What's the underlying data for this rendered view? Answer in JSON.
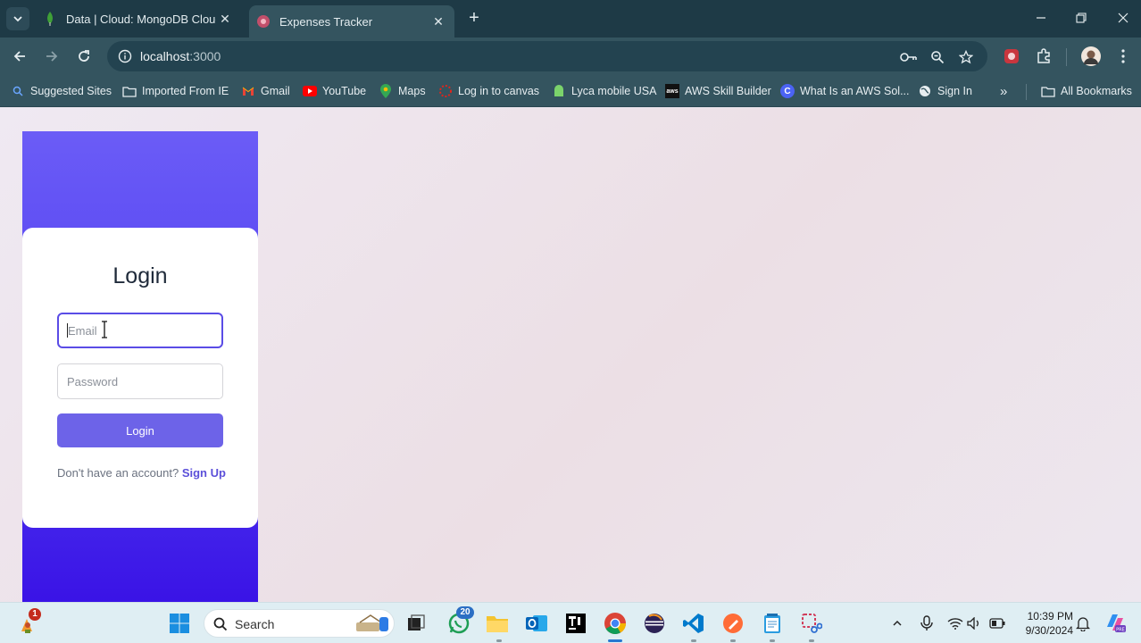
{
  "browser": {
    "tabs": [
      {
        "title": "Data | Cloud: MongoDB Cloud",
        "favicon": "mongodb-leaf-icon",
        "active": false
      },
      {
        "title": "Expenses Tracker",
        "favicon": "react-app-icon",
        "active": true
      }
    ],
    "url": {
      "host": "localhost",
      "port": ":3000"
    },
    "bookmarks": [
      {
        "label": "Suggested Sites",
        "icon": "suggested-sites-icon"
      },
      {
        "label": "Imported From IE",
        "icon": "folder-icon"
      },
      {
        "label": "Gmail",
        "icon": "gmail-icon"
      },
      {
        "label": "YouTube",
        "icon": "youtube-icon"
      },
      {
        "label": "Maps",
        "icon": "maps-icon"
      },
      {
        "label": "Log in to canvas",
        "icon": "canvas-icon"
      },
      {
        "label": "Lyca mobile USA",
        "icon": "lyca-icon"
      },
      {
        "label": "AWS Skill Builder",
        "icon": "aws-icon"
      },
      {
        "label": "What Is an AWS Sol...",
        "icon": "c-icon"
      },
      {
        "label": "Sign In",
        "icon": "globe-icon"
      }
    ],
    "all_bookmarks": "All Bookmarks",
    "more": "»"
  },
  "login": {
    "heading": "Login",
    "email_placeholder": "Email",
    "password_placeholder": "Password",
    "button": "Login",
    "no_account": "Don't have an account?",
    "signup": "Sign Up"
  },
  "taskbar": {
    "search_label": "Search",
    "whatsapp_badge": "20",
    "widgets_badge": "1",
    "time": "10:39 PM",
    "date": "9/30/2024"
  },
  "colors": {
    "titlebar": "#1e3a46",
    "toolbar": "#34545f",
    "accent": "#6d63e8",
    "panel_top": "#6b5cf6",
    "panel_bottom": "#3a13e6"
  }
}
